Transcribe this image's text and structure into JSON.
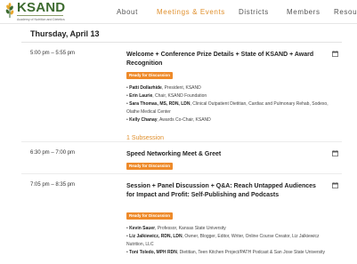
{
  "brand": {
    "name": "KSAND",
    "tagline": "Academy of Nutrition and Dietetics"
  },
  "nav": {
    "items": [
      {
        "label": "About"
      },
      {
        "label": "Meetings & Events"
      },
      {
        "label": "Districts"
      },
      {
        "label": "Members"
      },
      {
        "label": "Resou"
      }
    ],
    "active": "Meetings & Events"
  },
  "schedule": {
    "day": "Thursday, April 13",
    "sessions": [
      {
        "time": "5:00 pm – 5:55 pm",
        "title": "Welcome + Conference Prize Details + State of KSAND + Award Recognition",
        "badge": "Ready for Discussion",
        "speakers": [
          {
            "name": "Patti Dollarhide",
            "role": ", President, KSAND"
          },
          {
            "name": "Erin Laurie",
            "role": ", Chair, KSAND Foundation"
          },
          {
            "name": "Sara Thomas, MS, RDN, LDN",
            "role": ", Clinical Outpatient Dietitian, Cardiac and Pulmonary Rehab, Sodexo, Olathe Medical Center"
          },
          {
            "name": "Kelly Chanay",
            "role": ", Awards Co-Chair, KSAND"
          }
        ],
        "subsession": "1 Subsession"
      },
      {
        "time": "6:30 pm – 7:00 pm",
        "title": "Speed Networking Meet & Greet",
        "badge": "Ready for Discussion",
        "speakers": []
      },
      {
        "time": "7:05 pm – 8:35 pm",
        "title": "Session + Panel Discussion + Q&A: Reach Untapped Audiences for Impact and Profit: Self-Publishing and Podcasts",
        "badge": "Ready for Discussion",
        "speakers": [
          {
            "name": "Kevin Sauer",
            "role": ", Professor, Kansas State University"
          },
          {
            "name": "Liz Jalkiewicz, RDN, LDN",
            "role": ", Owner, Blogger, Editor, Writer, Online Course Creator, Liz Jalkiewicz Nutrition, LLC"
          },
          {
            "name": "Toni Toledo, MPH RDN",
            "role": ", Dietitian, Teen Kitchen Project/PATH Podcast & San Jose State University"
          }
        ]
      }
    ]
  },
  "colors": {
    "accent": "#ee8a2a",
    "brand_green": "#3d6b2f",
    "nav_active": "#e0902e"
  },
  "icons": {
    "calendar": "calendar-add-icon"
  }
}
